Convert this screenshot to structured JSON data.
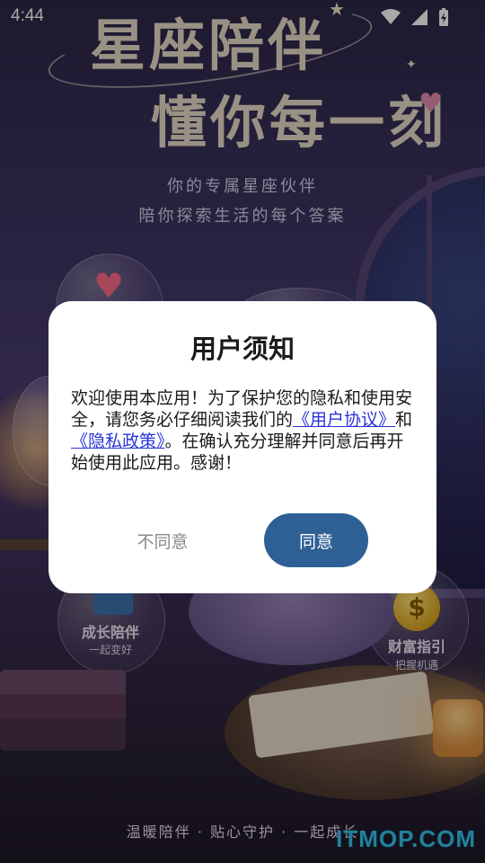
{
  "status": {
    "time": "4:44"
  },
  "hero": {
    "line1": "星座陪伴",
    "line2": "懂你每一刻",
    "subtitle1": "你的专属星座伙伴",
    "subtitle2": "陪你探索生活的每个答案"
  },
  "features": {
    "growth": {
      "label": "成长陪伴",
      "sub": "一起变好"
    },
    "wealth": {
      "label": "财富指引",
      "sub": "把握机遇"
    }
  },
  "footer": {
    "tagline": "温暖陪伴 · 贴心守护 · 一起成长"
  },
  "watermark": "ITMOP.COM",
  "dialog": {
    "title": "用户须知",
    "body_prefix": "欢迎使用本应用！为了保护您的隐私和使用安全，请您务必仔细阅读我们的",
    "user_agreement_link": "《用户协议》",
    "and_text": "和",
    "privacy_link": "《隐私政策》",
    "body_suffix": "。在确认充分理解并同意后再开始使用此应用。感谢！",
    "disagree_label": "不同意",
    "agree_label": "同意"
  },
  "colors": {
    "agree_button": "#2e6096",
    "link": "#2a35d6",
    "watermark": "#36c2e8"
  }
}
